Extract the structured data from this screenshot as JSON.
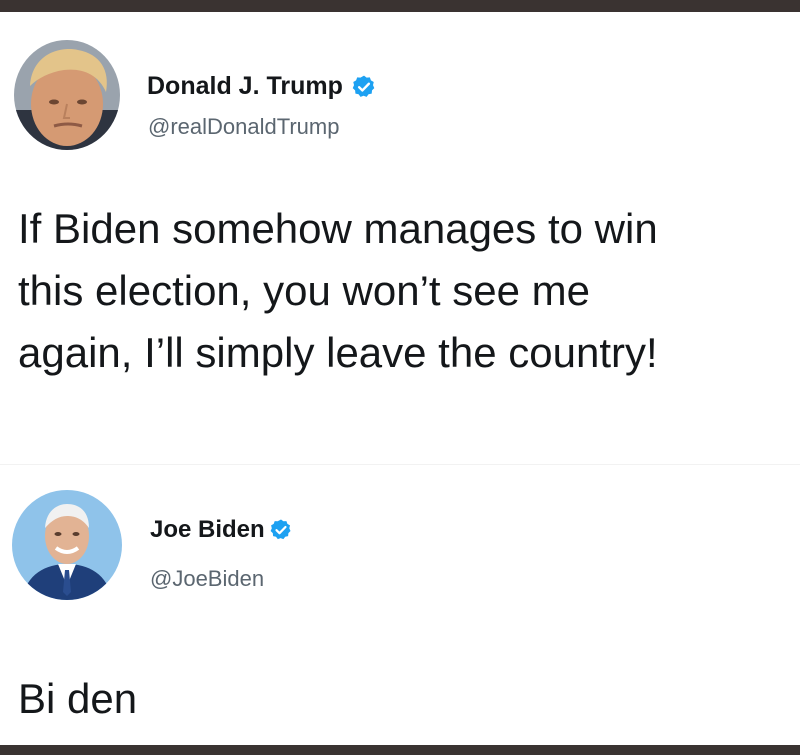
{
  "tweets": [
    {
      "author": {
        "name": "Donald J. Trump",
        "handle": "@realDonaldTrump",
        "verified": true
      },
      "text_lines": [
        "If Biden somehow manages to win",
        "this election, you won’t see me",
        "again, I’ll simply leave the country!"
      ]
    },
    {
      "author": {
        "name": "Joe Biden",
        "handle": "@JoeBiden",
        "verified": true
      },
      "text_lines": [
        "Bi den"
      ]
    }
  ],
  "colors": {
    "verified_badge": "#1da1f2",
    "frame": "#3a3331",
    "text": "#14171a",
    "handle": "#5b6670"
  },
  "icons": {
    "verified": "verified-badge-icon"
  }
}
